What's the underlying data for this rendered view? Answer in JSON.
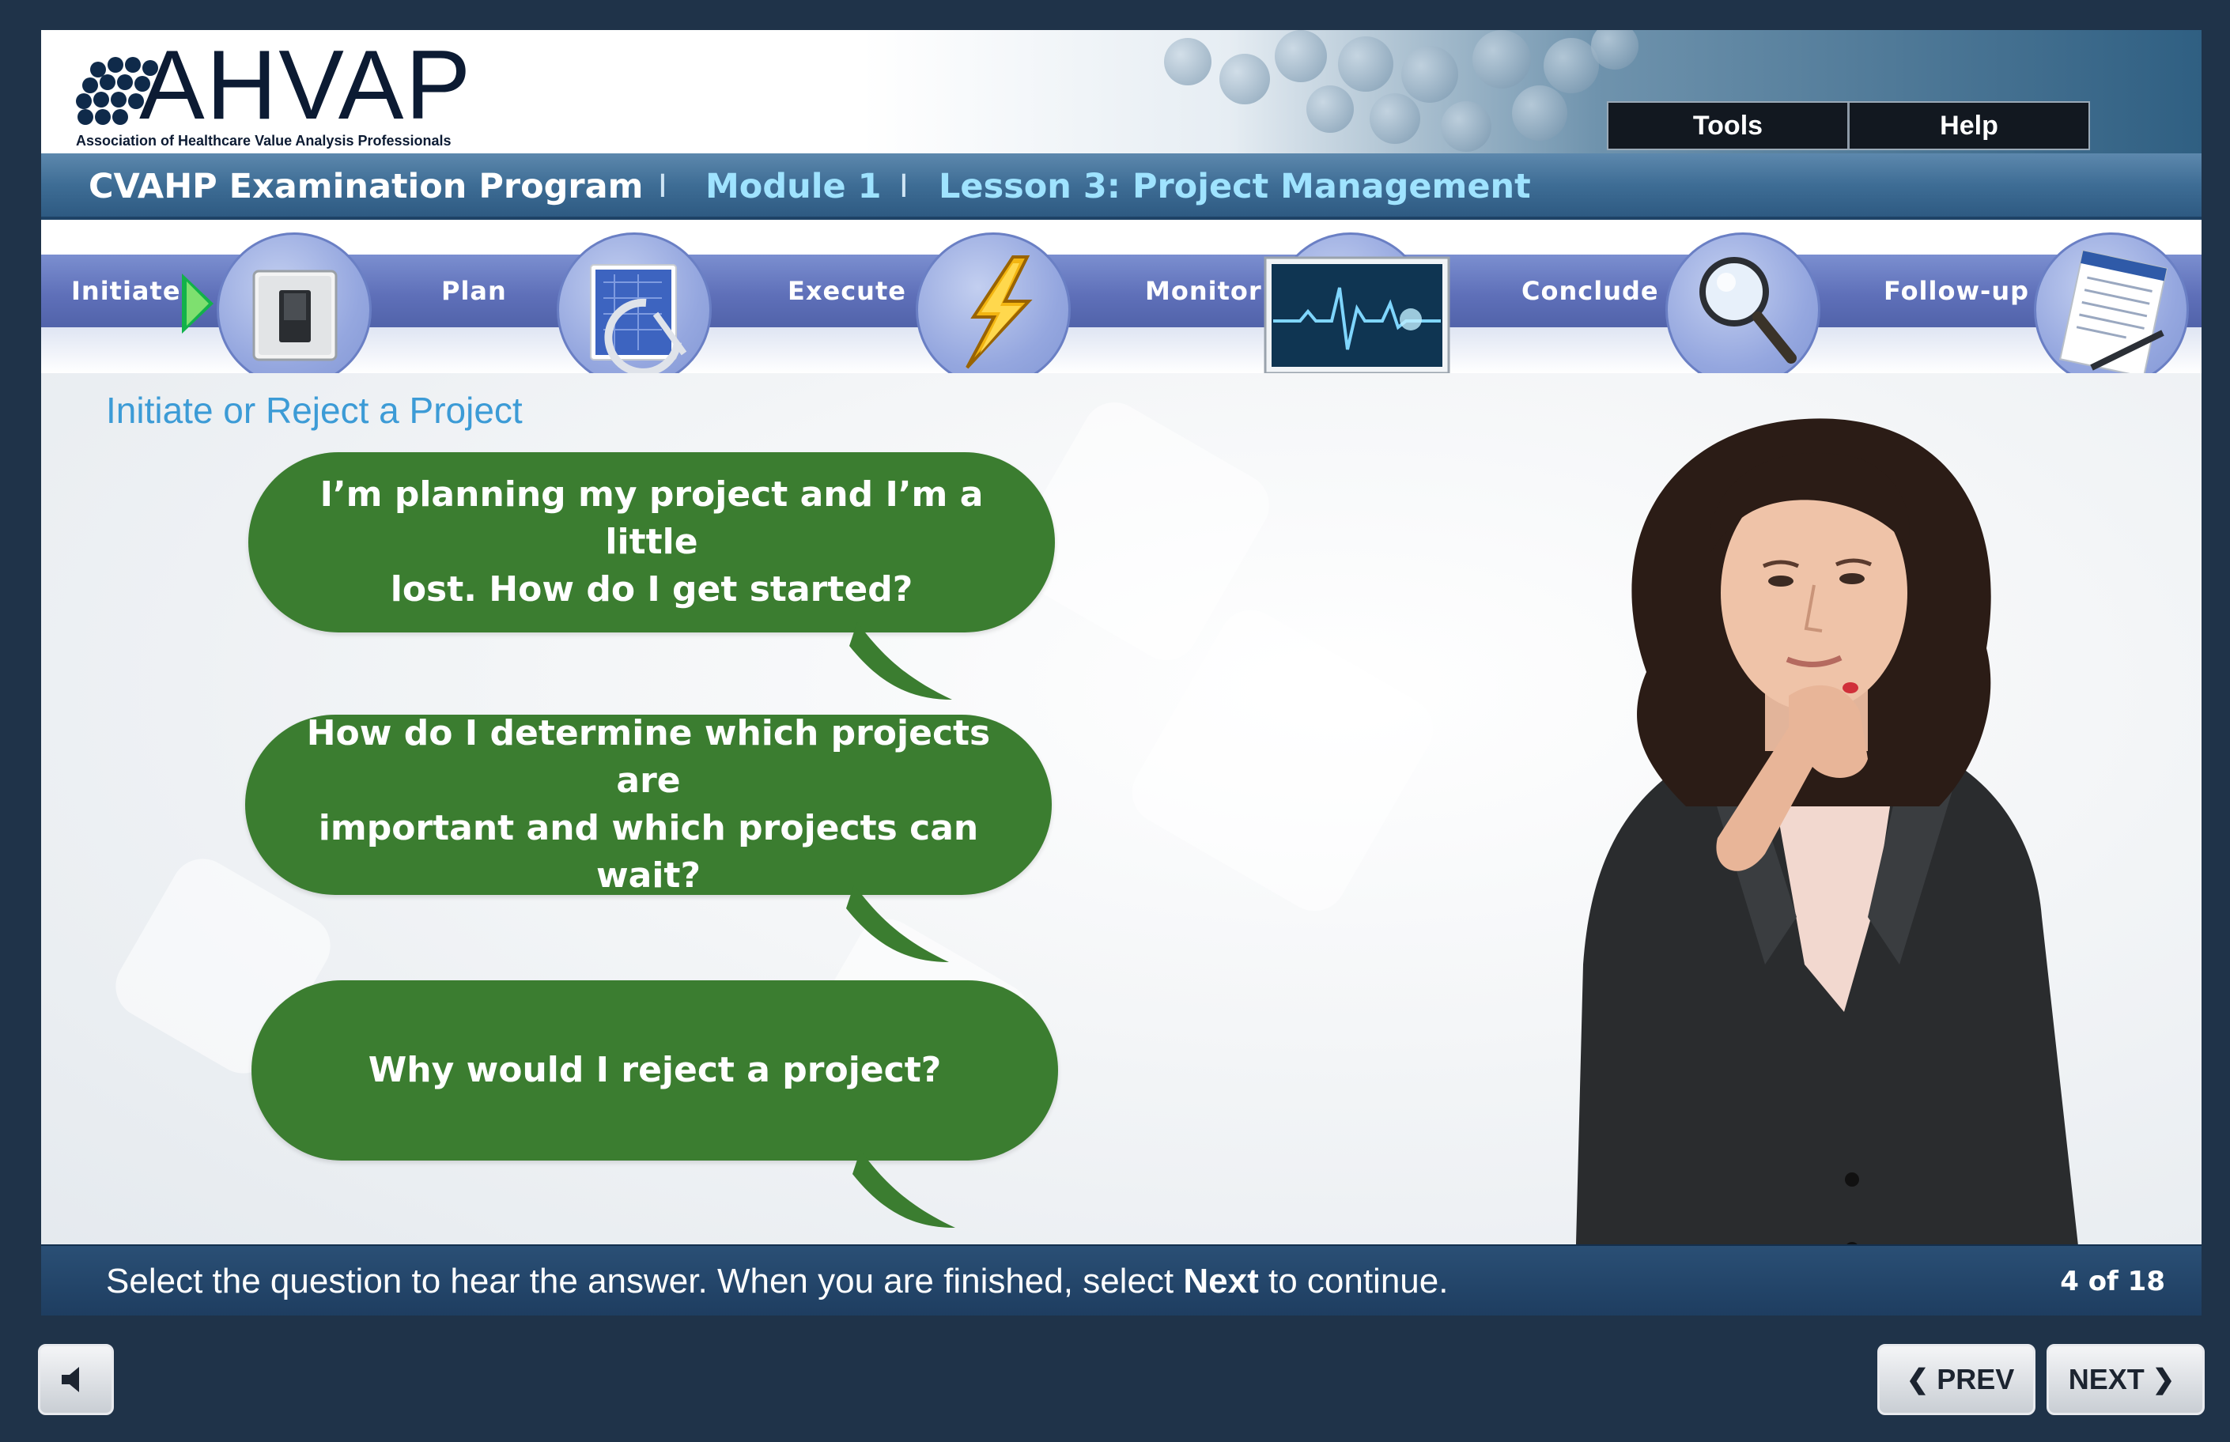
{
  "header": {
    "logo_text": "AHVAP",
    "logo_tagline": "Association of Healthcare Value Analysis Professionals",
    "tools_label": "Tools",
    "help_label": "Help"
  },
  "breadcrumb": {
    "program": "CVAHP Examination Program",
    "separator": "I",
    "module": "Module 1",
    "lesson": "Lesson 3: Project Management"
  },
  "phases": [
    {
      "label": "Initiate",
      "icon": "light-switch-icon",
      "active": true
    },
    {
      "label": "Plan",
      "icon": "blueprint-icon",
      "active": false
    },
    {
      "label": "Execute",
      "icon": "lightning-bolt-icon",
      "active": false
    },
    {
      "label": "Monitor",
      "icon": "heart-monitor-icon",
      "active": false
    },
    {
      "label": "Conclude",
      "icon": "magnifying-glass-icon",
      "active": false
    },
    {
      "label": "Follow-up",
      "icon": "notepad-pen-icon",
      "active": false
    }
  ],
  "content": {
    "section_title": "Initiate or Reject a Project",
    "questions": [
      "I’m planning my project and I’m a little\nlost. How do I get started?",
      "How do I determine which projects are\nimportant and which projects can wait?",
      "Why would I reject a project?"
    ]
  },
  "footer": {
    "instruction_prefix": "Select the question to hear the answer. When you are finished, select ",
    "instruction_bold": "Next",
    "instruction_suffix": " to continue.",
    "page_count": "4 of 18"
  },
  "controls": {
    "prev_label": "PREV",
    "next_label": "NEXT",
    "audio_icon": "speaker-icon"
  },
  "colors": {
    "bubble_green": "#3b7d30",
    "breadcrumb_highlight": "#9fe3ff",
    "section_title_blue": "#3c9bd6",
    "phase_band": "#5f70b9",
    "active_arrow": "#12b24a"
  }
}
